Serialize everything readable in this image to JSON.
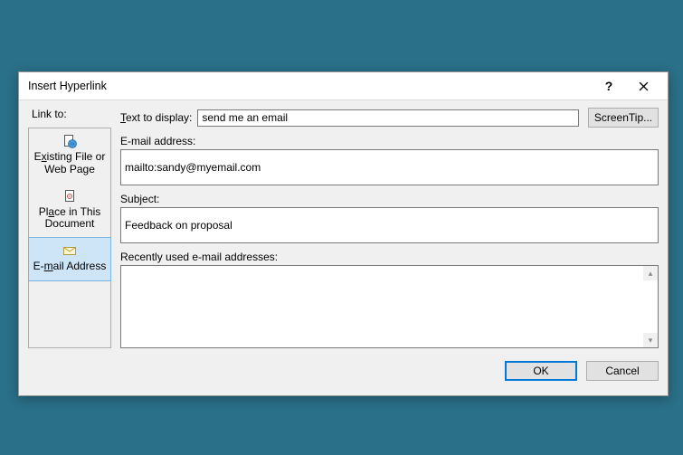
{
  "dialog": {
    "title": "Insert Hyperlink",
    "help_icon": "?",
    "close_icon": "×"
  },
  "link_to_label": "Link to:",
  "nav": {
    "existing": "Existing File or\nWeb Page",
    "place": "Place in This\nDocument",
    "email": "E-mail Address"
  },
  "fields": {
    "text_to_display_label": "Text to display:",
    "text_to_display_value": "send me an email",
    "email_label": "E-mail address:",
    "email_value": "mailto:sandy@myemail.com",
    "subject_label": "Subject:",
    "subject_value": "Feedback on proposal",
    "recent_label": "Recently used e-mail addresses:"
  },
  "buttons": {
    "screentip": "ScreenTip...",
    "ok": "OK",
    "cancel": "Cancel"
  }
}
